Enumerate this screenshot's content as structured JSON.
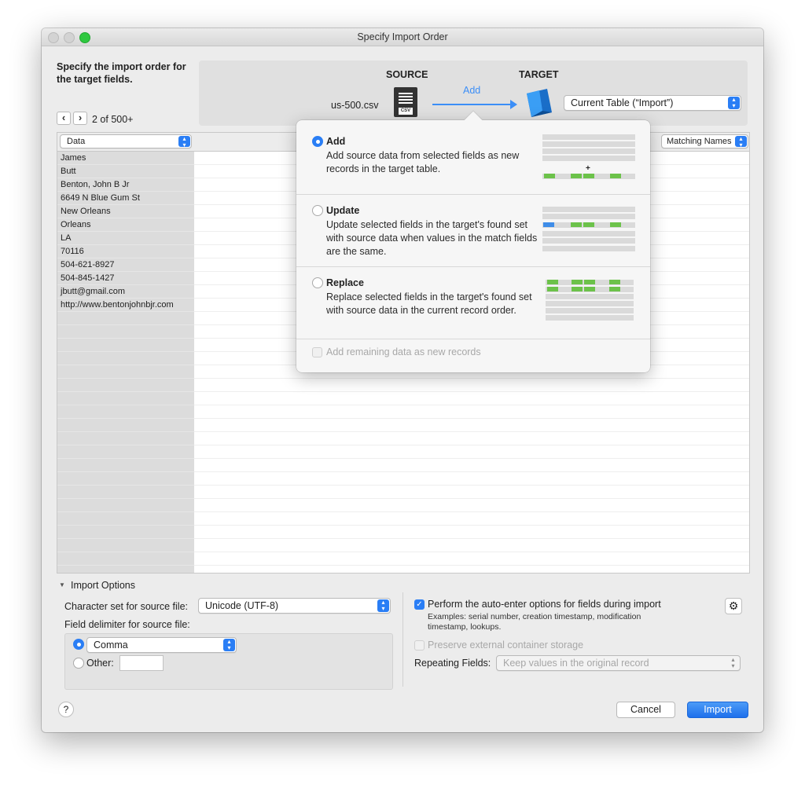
{
  "window": {
    "title": "Specify Import Order"
  },
  "header": {
    "instruction": "Specify the import order for the target fields.",
    "record_count": "2 of 500+"
  },
  "mapping": {
    "source_label": "SOURCE",
    "target_label": "TARGET",
    "source_file": "us-500.csv",
    "csv_icon_text": "CSV",
    "action_label": "Add",
    "target_table": "Current Table (“Import”)"
  },
  "table": {
    "source_column_header": "Data",
    "target_column_header": "Matching Names",
    "source_values": [
      "James",
      "Butt",
      "Benton, John B Jr",
      "6649 N Blue Gum St",
      "New Orleans",
      "Orleans",
      "LA",
      "70116",
      "504-621-8927",
      "504-845-1427",
      "jbutt@gmail.com",
      "http://www.bentonjohnbjr.com"
    ]
  },
  "import_action_popover": {
    "options": [
      {
        "title": "Add",
        "description": "Add source data from selected fields as new records in the target table.",
        "selected": true
      },
      {
        "title": "Update",
        "description": "Update selected fields in the target's found set with source data when values in the match fields are the same.",
        "selected": false
      },
      {
        "title": "Replace",
        "description": "Replace selected fields in the target's found set with source data in the current record order.",
        "selected": false
      }
    ],
    "remaining_data_label": "Add remaining data as new records"
  },
  "import_options": {
    "section_title": "Import Options",
    "charset_label": "Character set for source file:",
    "charset_value": "Unicode (UTF-8)",
    "delimiter_label": "Field delimiter for source file:",
    "delimiter_comma": "Comma",
    "delimiter_other": "Other:",
    "auto_enter_label": "Perform the auto-enter options for fields during import",
    "auto_enter_examples": "Examples: serial number, creation timestamp, modification timestamp, lookups.",
    "preserve_label": "Preserve external container storage",
    "repeating_label": "Repeating Fields:",
    "repeating_value": "Keep values in the original record"
  },
  "footer": {
    "help": "?",
    "cancel": "Cancel",
    "import": "Import"
  },
  "colors": {
    "accent": "#2a7ef5",
    "green": "#6cc24a",
    "traffic_zoom": "#2fc840"
  }
}
